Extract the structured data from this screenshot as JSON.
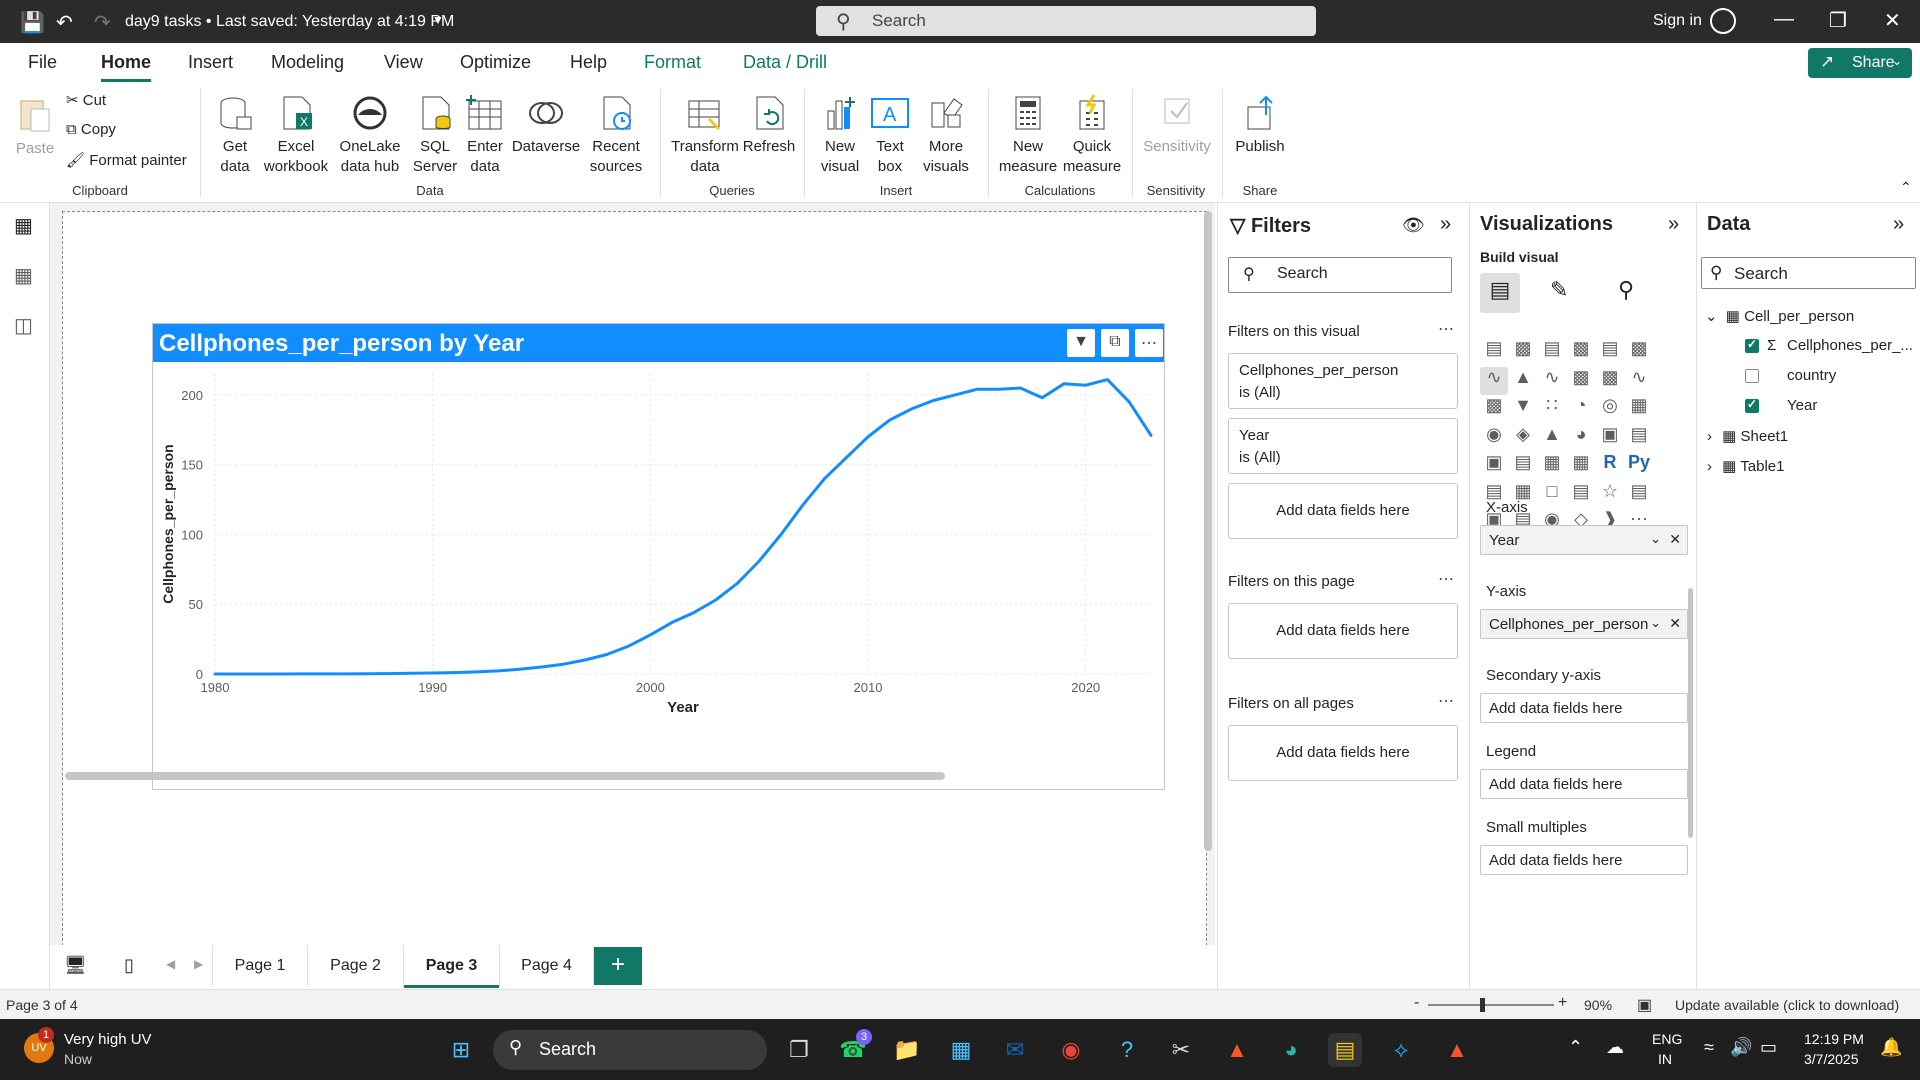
{
  "titlebar": {
    "doc_title": "day9 tasks • Last saved: Yesterday at 4:19 PM",
    "search_placeholder": "Search",
    "signin": "Sign in"
  },
  "menu": {
    "tabs": [
      "File",
      "Home",
      "Insert",
      "Modeling",
      "View",
      "Optimize",
      "Help",
      "Format",
      "Data / Drill"
    ],
    "active": "Home",
    "share": "Share"
  },
  "ribbon": {
    "paste": "Paste",
    "cut": "Cut",
    "copy": "Copy",
    "format_painter": "Format painter",
    "get_data": "Get data",
    "excel_workbook": "Excel workbook",
    "onelake": "OneLake data hub",
    "sql_server": "SQL Server",
    "enter_data": "Enter data",
    "dataverse": "Dataverse",
    "recent_sources": "Recent sources",
    "transform_data": "Transform data",
    "refresh": "Refresh",
    "new_visual": "New visual",
    "text_box": "Text box",
    "more_visuals": "More visuals",
    "new_measure": "New measure",
    "quick_measure": "Quick measure",
    "sensitivity": "Sensitivity",
    "publish": "Publish",
    "groups": {
      "clipboard": "Clipboard",
      "data": "Data",
      "queries": "Queries",
      "insert": "Insert",
      "calculations": "Calculations",
      "sensitivity": "Sensitivity",
      "share": "Share"
    }
  },
  "visual": {
    "title": "Cellphones_per_person by Year"
  },
  "chart_data": {
    "type": "line",
    "title": "Cellphones_per_person by Year",
    "xlabel": "Year",
    "ylabel": "Cellphones_per_person",
    "xlim": [
      1980,
      2023
    ],
    "ylim": [
      0,
      215
    ],
    "x_ticks": [
      "1980",
      "1990",
      "2000",
      "2010",
      "2020"
    ],
    "y_ticks": [
      "0",
      "50",
      "100",
      "150",
      "200"
    ],
    "grid": true,
    "color": "#118dff",
    "series": [
      {
        "x": [
          1980,
          1981,
          1982,
          1983,
          1984,
          1985,
          1986,
          1987,
          1988,
          1989,
          1990,
          1991,
          1992,
          1993,
          1994,
          1995,
          1996,
          1997,
          1998,
          1999,
          2000,
          2001,
          2002,
          2003,
          2004,
          2005,
          2006,
          2007,
          2008,
          2009,
          2010,
          2011,
          2012,
          2013,
          2014,
          2015,
          2016,
          2017,
          2018,
          2019,
          2020,
          2021,
          2022,
          2023
        ],
        "y": [
          0,
          0,
          0,
          0,
          0.1,
          0.1,
          0.1,
          0.2,
          0.3,
          0.5,
          0.7,
          1,
          1.5,
          2.2,
          3.4,
          5,
          7,
          10,
          14,
          20,
          28,
          37,
          44,
          53,
          65,
          81,
          100,
          121,
          140,
          155,
          170,
          182,
          190,
          196,
          200,
          204,
          204,
          205,
          198,
          208,
          207,
          211,
          195,
          171
        ]
      }
    ]
  },
  "pages": {
    "tabs": [
      "Page 1",
      "Page 2",
      "Page 3",
      "Page 4"
    ],
    "active": "Page 3",
    "add": "+"
  },
  "status": {
    "page": "Page 3 of 4",
    "zoom": "90%",
    "update": "Update available (click to download)"
  },
  "filters": {
    "title": "Filters",
    "search": "Search",
    "on_visual": "Filters on this visual",
    "card1_name": "Cellphones_per_person",
    "card1_state": "is (All)",
    "card2_name": "Year",
    "card2_state": "is (All)",
    "add_fields": "Add data fields here",
    "on_page": "Filters on this page",
    "on_all": "Filters on all pages"
  },
  "viz": {
    "title": "Visualizations",
    "build": "Build visual",
    "xaxis_label": "X-axis",
    "xaxis_value": "Year",
    "yaxis_label": "Y-axis",
    "yaxis_value": "Cellphones_per_person",
    "secondary": "Secondary y-axis",
    "legend": "Legend",
    "small_multiples": "Small multiples",
    "add_fields": "Add data fields here"
  },
  "data": {
    "title": "Data",
    "search": "Search",
    "table1": "Cell_per_person",
    "field1": "Cellphones_per_...",
    "field2": "country",
    "field3": "Year",
    "table2": "Sheet1",
    "table3": "Table1"
  },
  "taskbar": {
    "weather_title": "Very high UV",
    "weather_sub": "Now",
    "weather_badge": "1",
    "search": "Search",
    "whatsapp_badge": "3",
    "lang1": "ENG",
    "lang2": "IN",
    "time": "12:19 PM",
    "date": "3/7/2025"
  }
}
